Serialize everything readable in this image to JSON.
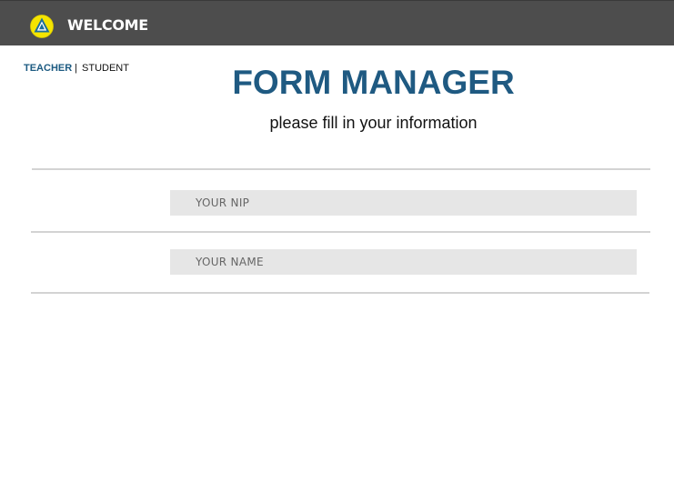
{
  "header": {
    "title": "WELCOME",
    "logo_icon": "triangle-emblem-icon",
    "background_color": "#4d4d4d",
    "logo_color": "#f5e400"
  },
  "roles": {
    "teacher": "TEACHER",
    "separator": "|",
    "student": "STUDENT",
    "active": "TEACHER",
    "active_color": "#1d5b82"
  },
  "main": {
    "title": "FORM MANAGER",
    "subtitle": "please fill in your information",
    "title_color": "#1f5a82"
  },
  "form": {
    "nip_placeholder": "YOUR NIP",
    "nip_value": "",
    "name_placeholder": "YOUR NAME",
    "name_value": ""
  }
}
